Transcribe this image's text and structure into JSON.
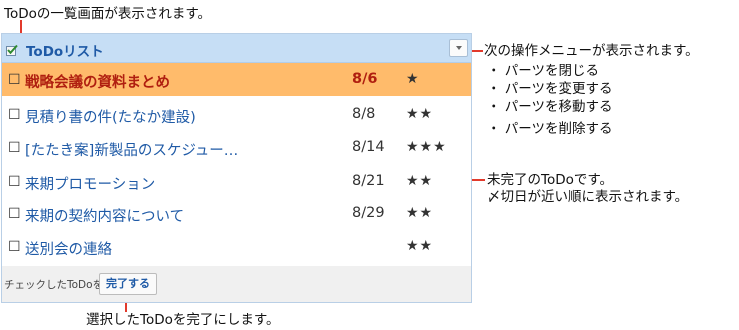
{
  "annotations": {
    "top": "ToDoの一覧画面が表示されます。",
    "menu": "次の操作メニューが表示されます。",
    "menu_items": [
      "・ パーツを閉じる",
      "・ パーツを変更する",
      "・ パーツを移動する",
      "・ パーツを削除する"
    ],
    "todo_line1": "未完了のToDoです。",
    "todo_line2": "〆切日が近い順に表示されます。",
    "bottom": "選択したToDoを完了にします。"
  },
  "panel": {
    "title": "ToDoリスト",
    "items": [
      {
        "check": "☐",
        "title": "戦略会議の資料まとめ",
        "date": "8/6",
        "stars": "★",
        "highlight": true
      },
      {
        "check": "☐",
        "title": "見積り書の件(たなか建設)",
        "date": "8/8",
        "stars": "★★"
      },
      {
        "check": "☐",
        "title": "[たたき案]新製品のスケジュー…",
        "date": "8/14",
        "stars": "★★★"
      },
      {
        "check": "☐",
        "title": "来期プロモーション",
        "date": "8/21",
        "stars": "★★"
      },
      {
        "check": "☐",
        "title": "来期の契約内容について",
        "date": "8/29",
        "stars": "★★"
      },
      {
        "check": "☐",
        "title": "送別会の連絡",
        "date": "",
        "stars": "★★"
      }
    ],
    "footer": {
      "label": "チェックしたToDoを",
      "button": "完了する"
    }
  },
  "icons": {
    "header": "checkbox-icon",
    "menu": "chevron-down-icon"
  },
  "colors": {
    "accent": "#1f5aa6",
    "highlight": "#ffbb6b",
    "header_bg": "#c6def5",
    "callout_line": "#e23a2c"
  }
}
